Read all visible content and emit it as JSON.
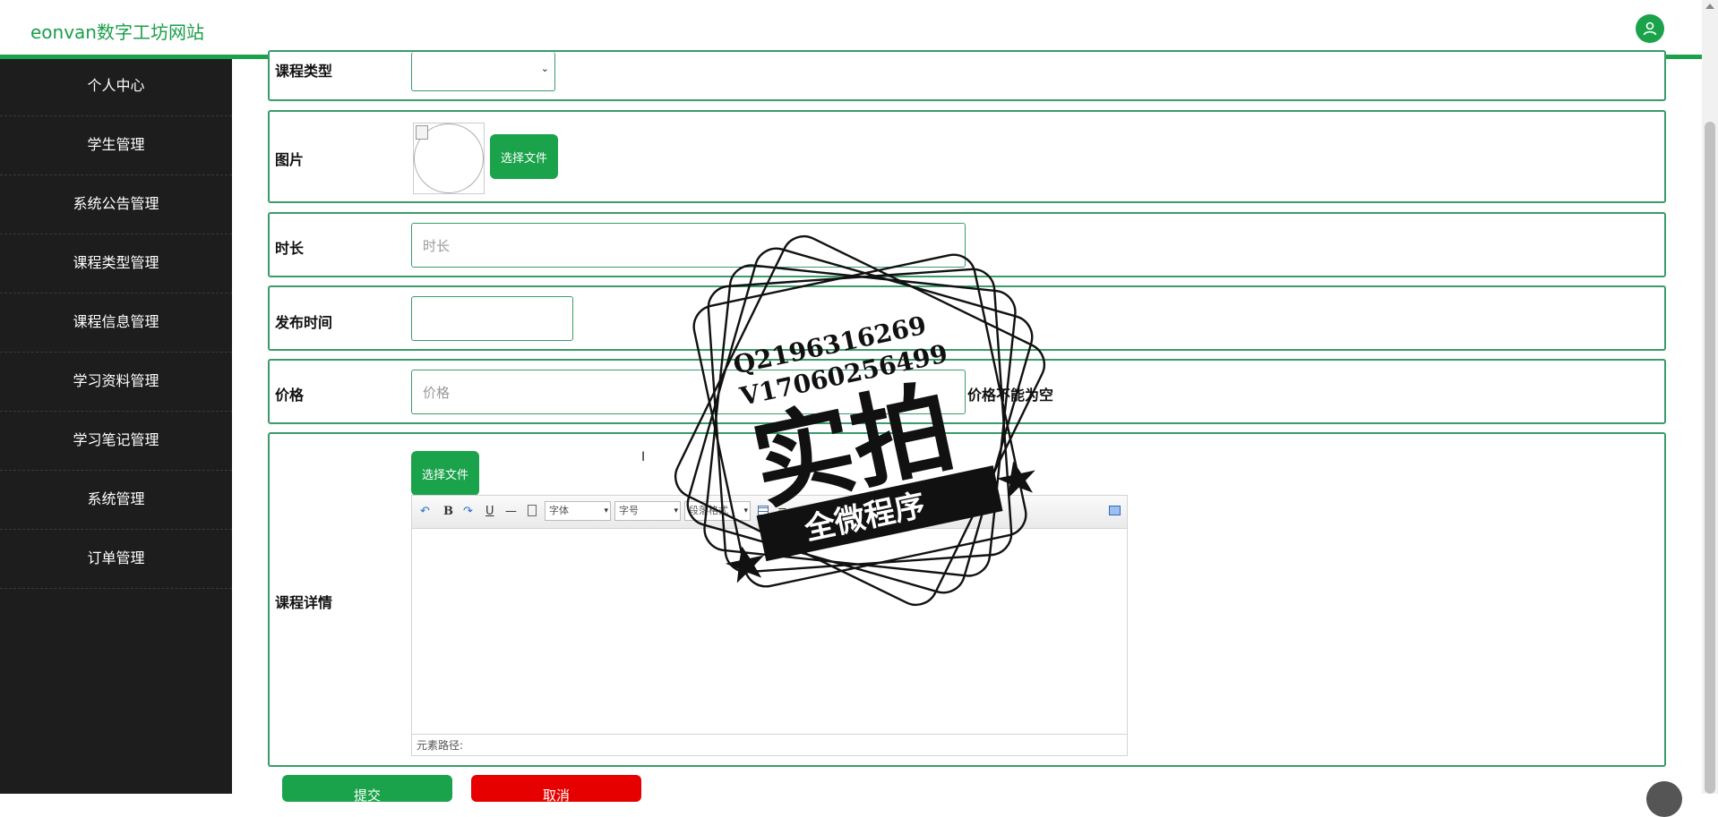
{
  "header": {
    "brand": "eonvan数字工坊网站"
  },
  "sidebar": {
    "items": [
      {
        "label": "个人中心"
      },
      {
        "label": "学生管理"
      },
      {
        "label": "系统公告管理"
      },
      {
        "label": "课程类型管理"
      },
      {
        "label": "课程信息管理"
      },
      {
        "label": "学习资料管理"
      },
      {
        "label": "学习笔记管理"
      },
      {
        "label": "系统管理"
      },
      {
        "label": "订单管理"
      }
    ]
  },
  "form": {
    "course_type": {
      "label": "课程类型"
    },
    "image": {
      "label": "图片",
      "upload_label": "选择文件"
    },
    "duration": {
      "label": "时长",
      "placeholder": "时长"
    },
    "publish_time": {
      "label": "发布时间"
    },
    "price": {
      "label": "价格",
      "placeholder": "价格",
      "error": "价格不能为空"
    },
    "details": {
      "label": "课程详情",
      "upload_label": "选择文件",
      "toolbar": {
        "font": "字体",
        "size": "字号",
        "paragraph": "段落格式"
      },
      "status_path": "元素路径:"
    },
    "submit_label": "提交",
    "cancel_label": "取消"
  },
  "watermark": {
    "contact_q": "Q2196316269",
    "contact_v": "V17060256499",
    "main": "实拍",
    "banner": "全微程序"
  }
}
